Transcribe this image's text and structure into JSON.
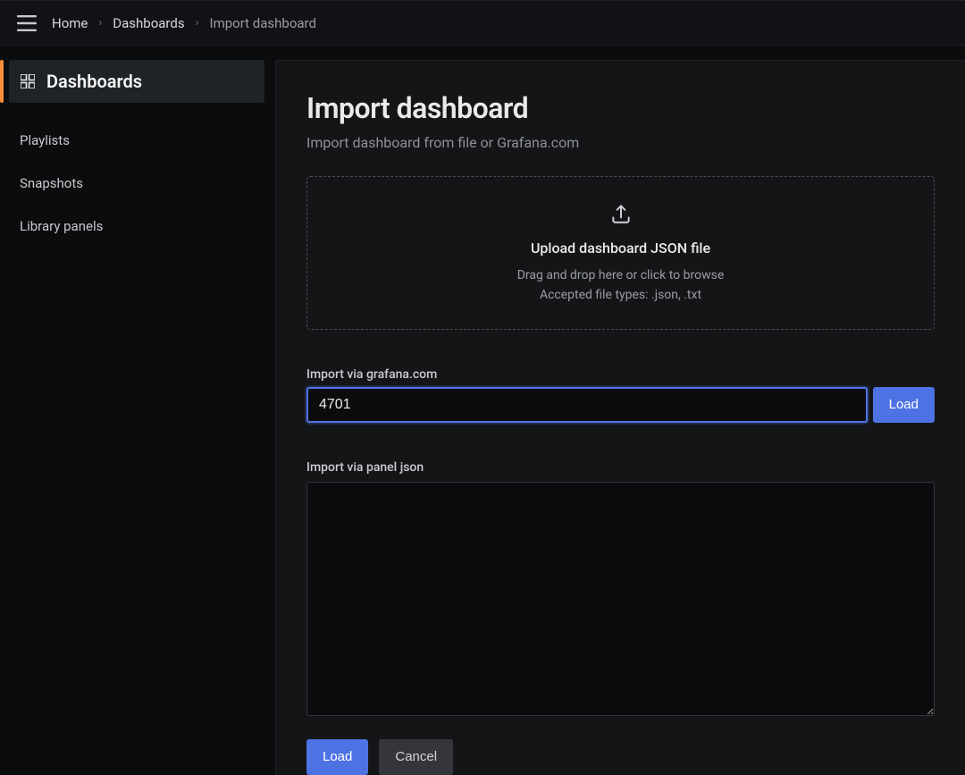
{
  "breadcrumbs": {
    "home": "Home",
    "dashboards": "Dashboards",
    "current": "Import dashboard"
  },
  "sidebar": {
    "items": [
      {
        "label": "Dashboards",
        "name": "sidebar-item-dashboards"
      },
      {
        "label": "Playlists",
        "name": "sidebar-item-playlists"
      },
      {
        "label": "Snapshots",
        "name": "sidebar-item-snapshots"
      },
      {
        "label": "Library panels",
        "name": "sidebar-item-library-panels"
      }
    ]
  },
  "page": {
    "title": "Import dashboard",
    "subtitle": "Import dashboard from file or Grafana.com"
  },
  "dropzone": {
    "title": "Upload dashboard JSON file",
    "hint1": "Drag and drop here or click to browse",
    "hint2": "Accepted file types: .json, .txt"
  },
  "grafana_com": {
    "label": "Import via grafana.com",
    "value": "4701",
    "load": "Load"
  },
  "panel_json": {
    "label": "Import via panel json",
    "value": ""
  },
  "buttons": {
    "load": "Load",
    "cancel": "Cancel"
  }
}
